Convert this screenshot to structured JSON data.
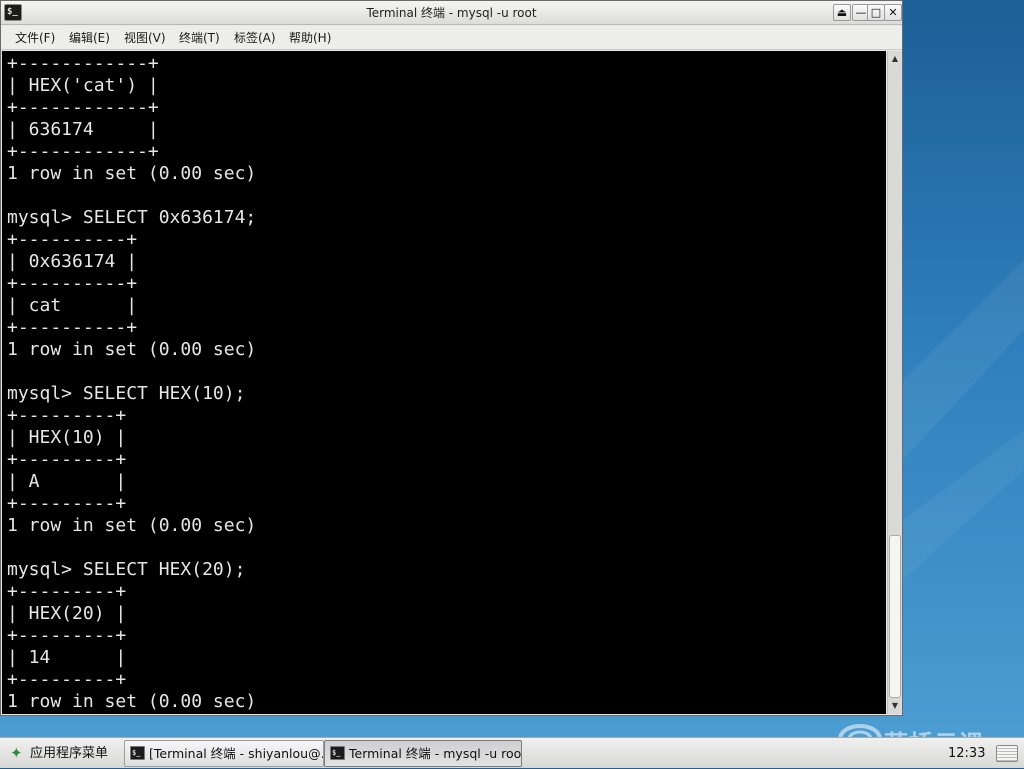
{
  "window": {
    "title": "Terminal 终端 - mysql -u root",
    "icon": "terminal-icon",
    "controls": [
      "shade-button",
      "minimize-button",
      "maximize-button",
      "close-button"
    ]
  },
  "menubar": {
    "items": [
      {
        "label": "文件(F)"
      },
      {
        "label": "编辑(E)"
      },
      {
        "label": "视图(V)"
      },
      {
        "label": "终端(T)"
      },
      {
        "label": "标签(A)"
      },
      {
        "label": "帮助(H)"
      }
    ]
  },
  "terminal": {
    "lines": [
      "+------------+",
      "| HEX('cat') |",
      "+------------+",
      "| 636174     |",
      "+------------+",
      "1 row in set (0.00 sec)",
      "",
      "mysql> SELECT 0x636174;",
      "+----------+",
      "| 0x636174 |",
      "+----------+",
      "| cat      |",
      "+----------+",
      "1 row in set (0.00 sec)",
      "",
      "mysql> SELECT HEX(10);",
      "+---------+",
      "| HEX(10) |",
      "+---------+",
      "| A       |",
      "+---------+",
      "1 row in set (0.00 sec)",
      "",
      "mysql> SELECT HEX(20);",
      "+---------+",
      "| HEX(20) |",
      "+---------+",
      "| 14      |",
      "+---------+",
      "1 row in set (0.00 sec)"
    ],
    "scroll_position": 1.0
  },
  "taskbar": {
    "start_label": "应用程序菜单",
    "tasks": [
      {
        "label": "[Terminal 终端 - shiyanlou@…",
        "active": false
      },
      {
        "label": "Terminal 终端 - mysql -u root",
        "active": true
      }
    ],
    "clock": "12:33"
  },
  "watermark": {
    "text": "蓝桥云课"
  },
  "colors": {
    "terminal_bg": "#000000",
    "terminal_fg": "#e6e6e6",
    "desktop": "#2f7fbd"
  }
}
